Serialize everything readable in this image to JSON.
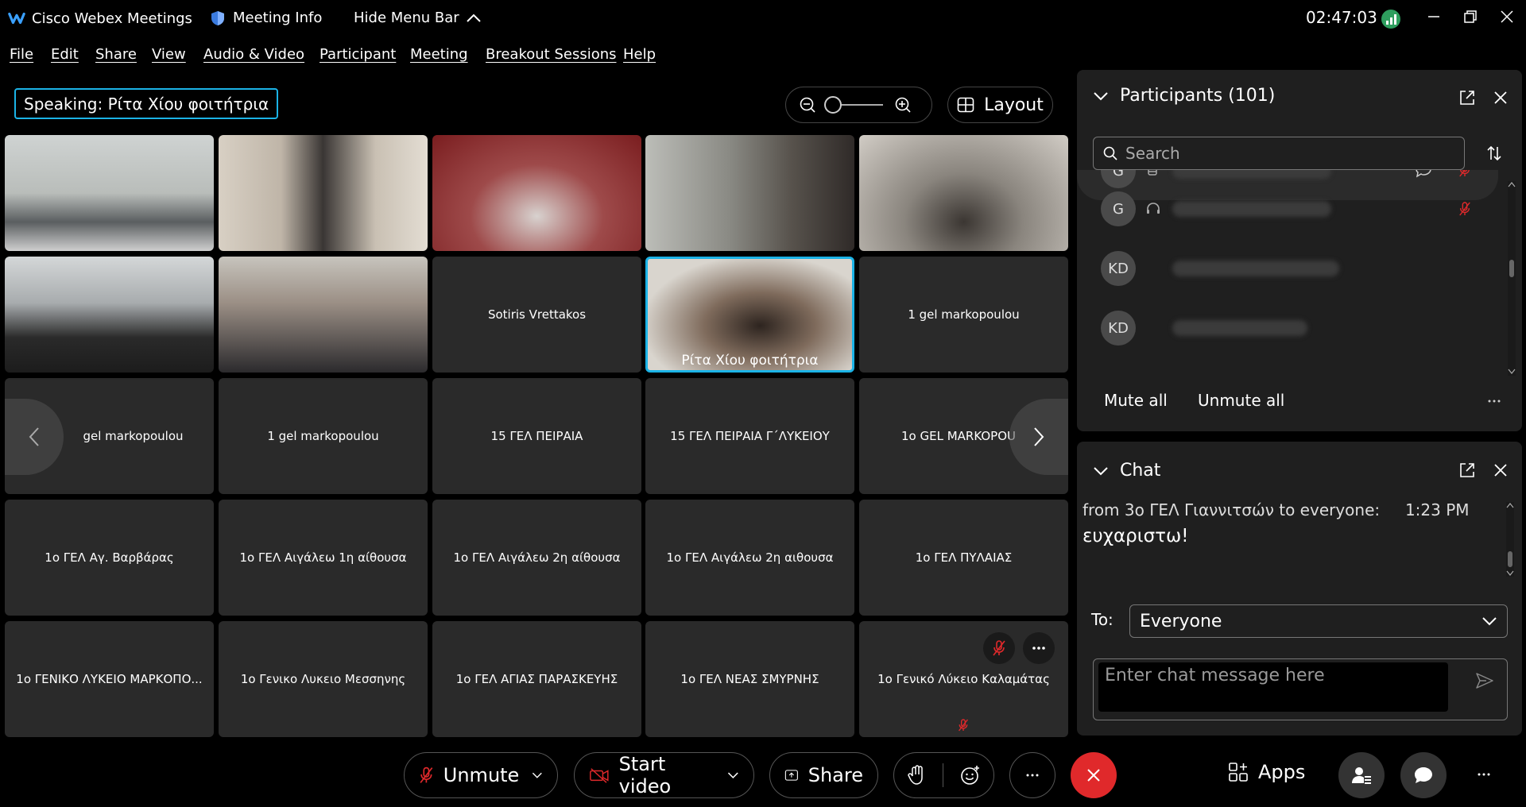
{
  "titlebar": {
    "app_name": "Cisco Webex Meetings",
    "meeting_info": "Meeting Info",
    "hide_menu": "Hide Menu Bar",
    "clock": "02:47:03"
  },
  "menu": {
    "file": "File",
    "edit": "Edit",
    "share": "Share",
    "view": "View",
    "audio_video": "Audio & Video",
    "participant": "Participant",
    "meeting": "Meeting",
    "breakout": "Breakout Sessions",
    "help": "Help"
  },
  "speaking": {
    "label": "Speaking:",
    "name": "Ρίτα Χίου φοιτήτρια"
  },
  "layout_label": "Layout",
  "tiles": {
    "sotiris": "Sotiris Vrettakos",
    "rita": "Ρίτα Χίου φοιτήτρια",
    "gel1": "1 gel markopoulou",
    "r3c1": "gel markopoulou",
    "r3c2": "1 gel markopoulou",
    "r3c3": "15 ΓΕΛ ΠΕΙΡΑΙΑ",
    "r3c4": "15 ΓΕΛ ΠΕΙΡΑΙΑ Γ΄ΛΥΚΕΙΟΥ",
    "r3c5": "1o GEL MARKOPOU",
    "r4c1": "1ο ΓΕΛ Αγ. Βαρβάρας",
    "r4c2": "1ο ΓΕΛ Αιγάλεω 1η αίθουσα",
    "r4c3": "1ο ΓΕΛ Αιγάλεω 2η αίθουσα",
    "r4c4": "1ο ΓΕΛ Αιγάλεω 2η αιθουσα",
    "r4c5": "1ο ΓΕΛ ΠΥΛΑΙΑΣ",
    "r5c1": "1ο ΓΕΝΙΚΟ ΛΥΚΕΙΟ ΜΑΡΚΟΠΟ...",
    "r5c2": "1ο Γενικο Λυκειο Μεσσηνης",
    "r5c3": "1ο ΓΕΛ ΑΓΙΑΣ ΠΑΡΑΣΚΕΥΗΣ",
    "r5c4": "1ο ΓΕΛ ΝΕΑΣ ΣΜΥΡΝΗΣ",
    "r5c5": "1ο Γενικό Λύκειο Καλαμάτας"
  },
  "participants": {
    "title": "Participants (101)",
    "search_placeholder": "Search",
    "rows": [
      {
        "initials": "G"
      },
      {
        "initials": "G"
      },
      {
        "initials": "KD"
      },
      {
        "initials": "KD"
      }
    ],
    "mute_all": "Mute all",
    "unmute_all": "Unmute all"
  },
  "chat": {
    "title": "Chat",
    "message_from": "from 3ο ΓΕΛ Γιαννιτσών to everyone:",
    "message_time": "1:23 PM",
    "message_text": "ευχαριστω!",
    "to_label": "To:",
    "to_value": "Everyone",
    "input_placeholder": "Enter chat message here"
  },
  "controls": {
    "unmute": "Unmute",
    "start_video": "Start video",
    "share": "Share",
    "apps": "Apps"
  },
  "colors": {
    "accent": "#1bb3e6",
    "end_call": "#e0292b",
    "mute_red": "#e0292b"
  }
}
